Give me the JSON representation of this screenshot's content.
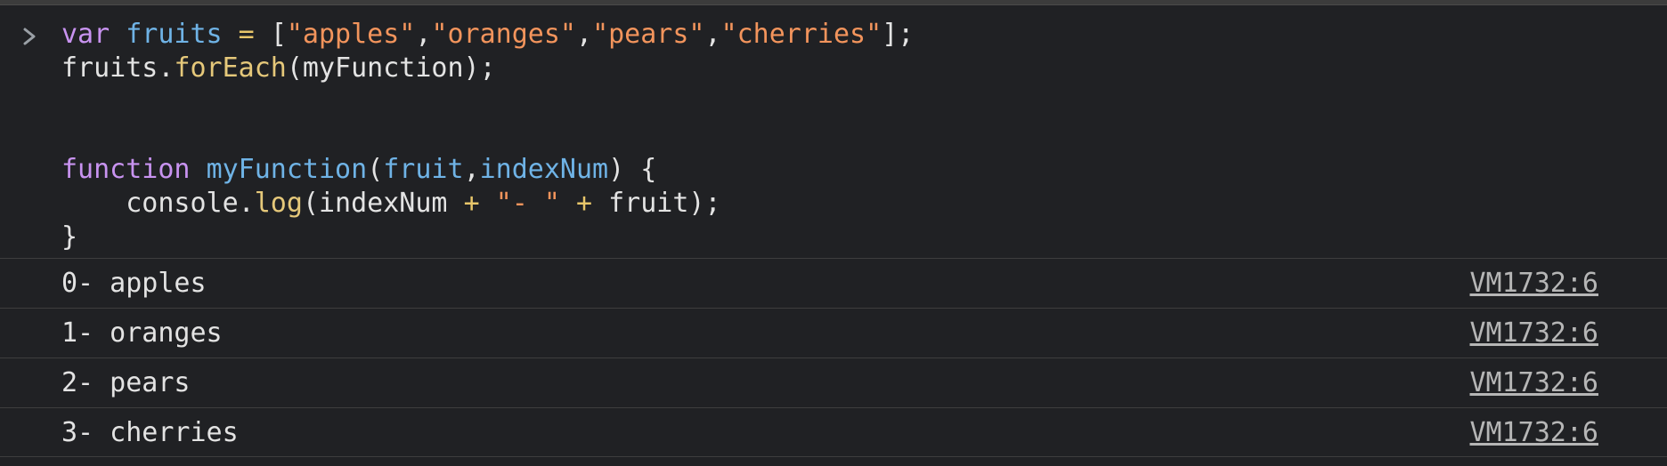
{
  "console": {
    "prompt_icon": "chevron-right-icon",
    "input": {
      "line1": {
        "kw": "var",
        "name": "fruits",
        "eq": " = ",
        "open": "[",
        "s1": "\"apples\"",
        "c1": ",",
        "s2": "\"oranges\"",
        "c2": ",",
        "s3": "\"pears\"",
        "c3": ",",
        "s4": "\"cherries\"",
        "close": "];"
      },
      "line2": {
        "obj": "fruits.",
        "method": "forEach",
        "args": "(myFunction);"
      },
      "line5": {
        "kw": "function",
        "name": "myFunction",
        "open": "(",
        "p1": "fruit",
        "comma": ",",
        "p2": "indexNum",
        "close": ") {"
      },
      "line6": {
        "indent": "    console.",
        "method": "log",
        "a1": "(indexNum ",
        "plus1": "+",
        "str": "\"- \"",
        "plus2": "+",
        "a2": " fruit);"
      },
      "line7": "}"
    },
    "logs": [
      {
        "text": "0- apples",
        "source": "VM1732:6"
      },
      {
        "text": "1- oranges",
        "source": "VM1732:6"
      },
      {
        "text": "2- pears",
        "source": "VM1732:6"
      },
      {
        "text": "3- cherries",
        "source": "VM1732:6"
      }
    ]
  }
}
